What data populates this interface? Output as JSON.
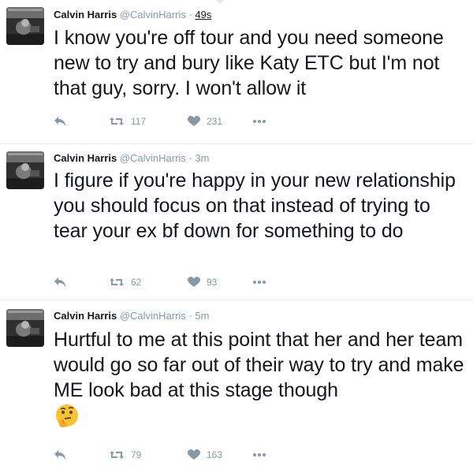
{
  "tweets": [
    {
      "name": "Calvin Harris",
      "handle": "@CalvinHarris",
      "separator": "·",
      "time": "49s",
      "text": "I know you're off tour and you need someone new to try and bury like Katy ETC but I'm not that guy, sorry. I won't allow it",
      "retweets": "117",
      "likes": "231"
    },
    {
      "name": "Calvin Harris",
      "handle": "@CalvinHarris",
      "separator": "·",
      "time": "3m",
      "text": "I figure if you're happy in your new relationship you should focus on that instead of trying to tear your ex bf down for something to do",
      "retweets": "62",
      "likes": "93"
    },
    {
      "name": "Calvin Harris",
      "handle": "@CalvinHarris",
      "separator": "·",
      "time": "5m",
      "text": "Hurtful to me at this point that her and her team would go so far out of their way to try and make ME look bad at this stage though",
      "emoji": "thinking-face",
      "retweets": "79",
      "likes": "163"
    }
  ],
  "icons": {
    "reply": "reply-icon",
    "retweet": "retweet-icon",
    "like": "heart-icon",
    "more": "more-icon"
  },
  "colors": {
    "text": "#14171a",
    "muted": "#8899a6",
    "divider": "#e6ecf0"
  }
}
